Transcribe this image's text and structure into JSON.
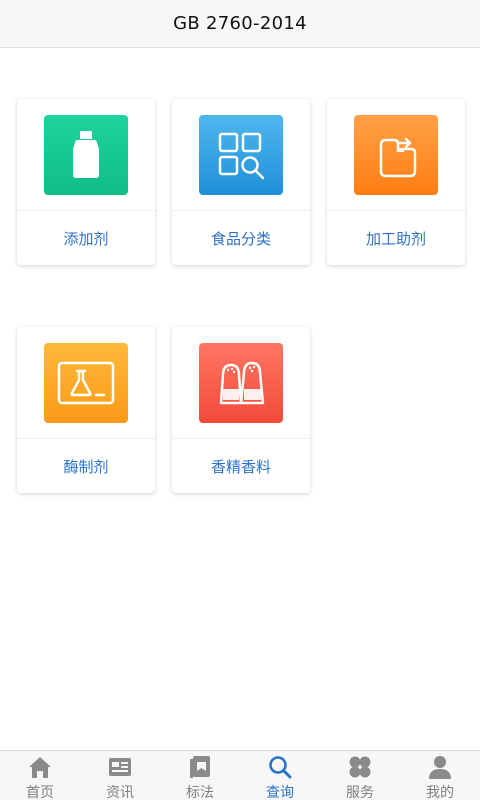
{
  "header": {
    "title": "GB 2760-2014"
  },
  "categories": [
    {
      "label": "添加剂",
      "icon": "bottle-icon",
      "color": "#12c793"
    },
    {
      "label": "食品分类",
      "icon": "grid-search-icon",
      "color": "#2a9ee3"
    },
    {
      "label": "加工助剂",
      "icon": "flow-arrow-icon",
      "color": "#ff8a24"
    },
    {
      "label": "酶制剂",
      "icon": "flask-icon",
      "color": "#fca828"
    },
    {
      "label": "香精香料",
      "icon": "salt-pepper-icon",
      "color": "#f75a45"
    }
  ],
  "tabs": [
    {
      "label": "首页",
      "icon": "home-icon"
    },
    {
      "label": "资讯",
      "icon": "news-icon"
    },
    {
      "label": "标法",
      "icon": "book-icon"
    },
    {
      "label": "查询",
      "icon": "search-icon",
      "active": true
    },
    {
      "label": "服务",
      "icon": "clover-icon"
    },
    {
      "label": "我的",
      "icon": "user-icon"
    }
  ],
  "colors": {
    "accent": "#2a73c8",
    "inactive": "#808080"
  }
}
